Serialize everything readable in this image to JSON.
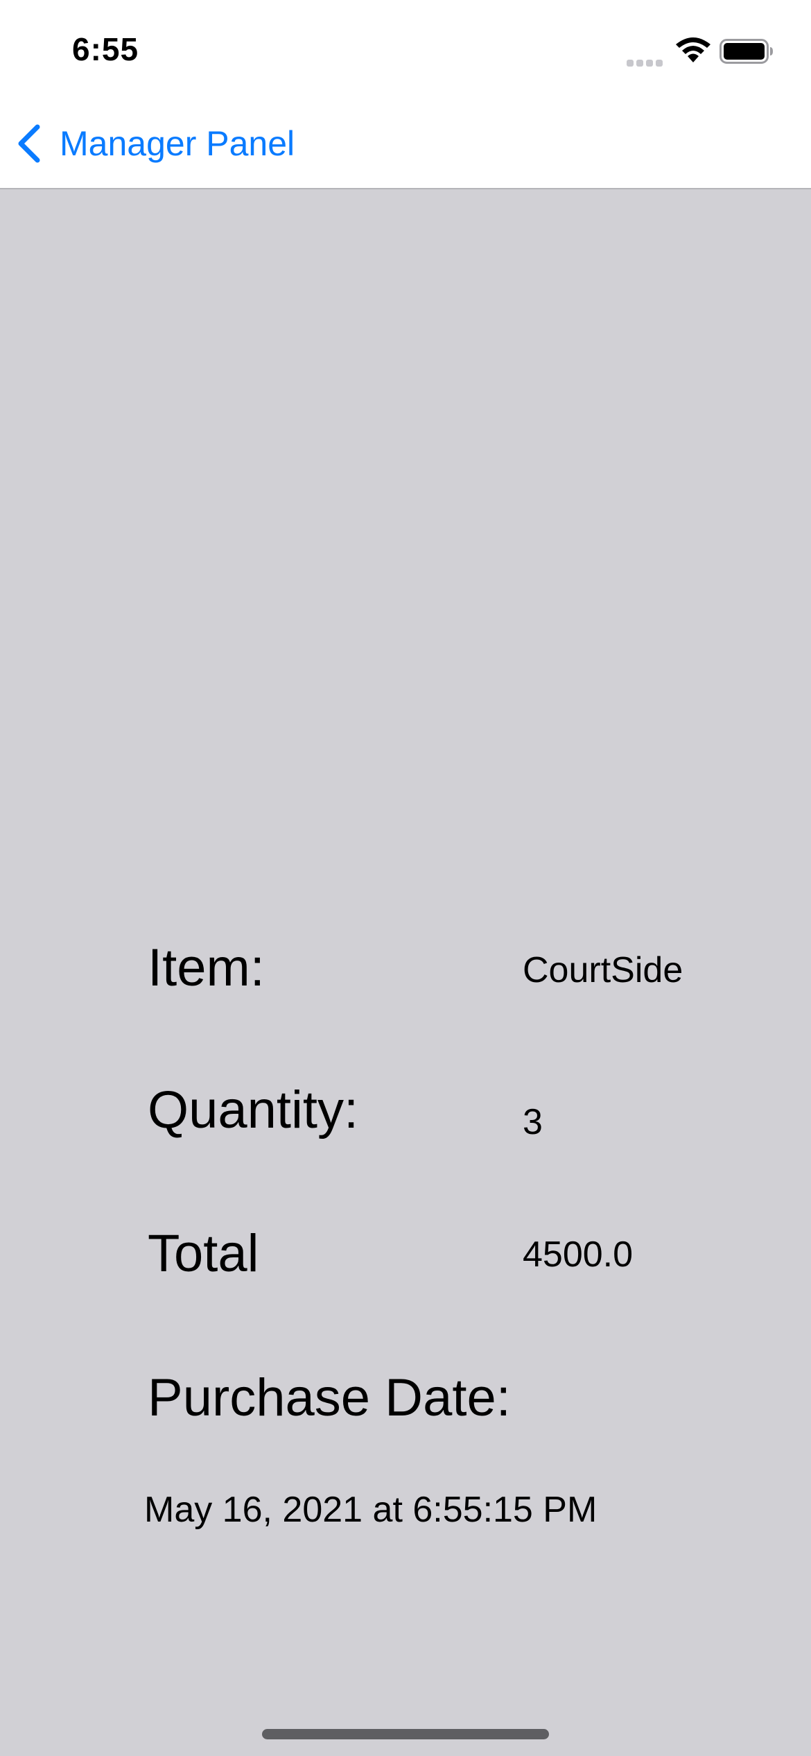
{
  "status_bar": {
    "time": "6:55",
    "icons": [
      "cellular-signal-icon",
      "wifi-icon",
      "battery-icon"
    ]
  },
  "nav_bar": {
    "back_label": "Manager Panel",
    "back_icon": "chevron-left-icon",
    "accent_color": "#0a7bff"
  },
  "details": {
    "item_label": "Item:",
    "item_value": "CourtSide",
    "quantity_label": "Quantity:",
    "quantity_value": "3",
    "total_label": "Total",
    "total_value": "4500.0",
    "purchase_date_label": "Purchase Date:",
    "purchase_date_value": "May 16, 2021 at 6:55:15 PM"
  },
  "colors": {
    "background": "#d1d0d5",
    "bar_background": "#ffffff"
  }
}
